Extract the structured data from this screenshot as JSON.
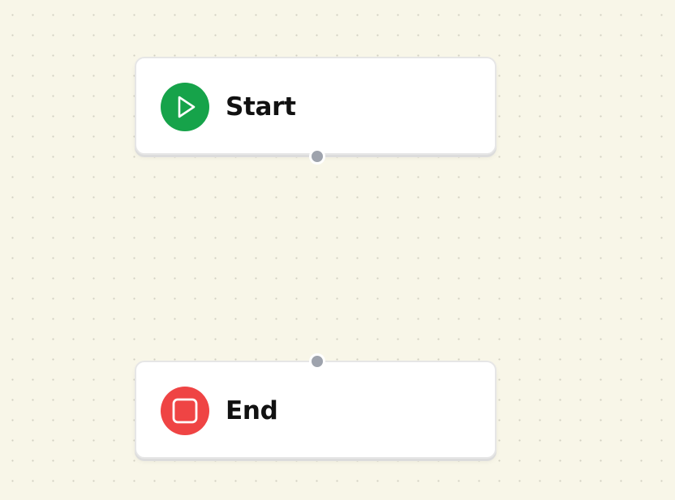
{
  "canvas": {
    "background_color": "#f8f6e8",
    "grid": "dots"
  },
  "nodes": [
    {
      "id": "start",
      "label": "Start",
      "icon": "play-icon",
      "icon_color": "#16a34a",
      "handle": "bottom"
    },
    {
      "id": "end",
      "label": "End",
      "icon": "stop-icon",
      "icon_color": "#ef4444",
      "handle": "top"
    }
  ],
  "colors": {
    "handle": "#9ea3ad",
    "node_background": "#ffffff",
    "node_border": "#e6e6e6"
  }
}
